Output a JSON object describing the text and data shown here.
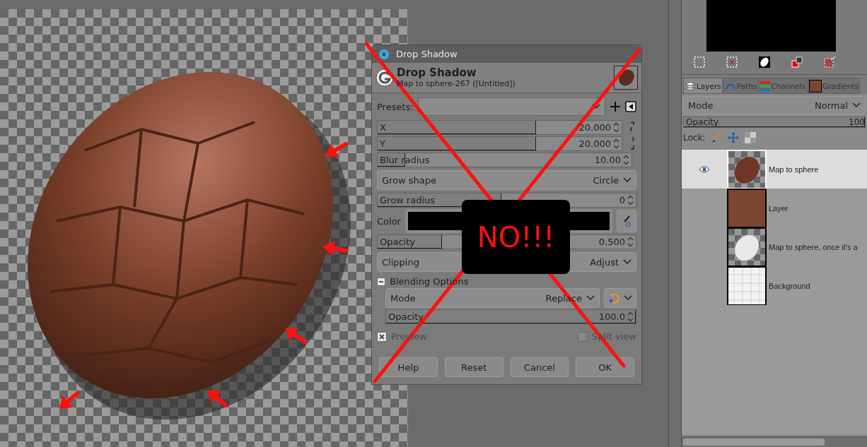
{
  "dialog": {
    "title": "Drop Shadow",
    "heading": "Drop Shadow",
    "subtitle": "Map to sphere-267 ([Untitled])",
    "presets_label": "Presets:",
    "fields": [
      {
        "kind": "slider",
        "label": "X",
        "value": "20.000",
        "level": 0.65
      },
      {
        "kind": "slider",
        "label": "Y",
        "value": "20.000",
        "level": 0.65
      },
      {
        "kind": "slider",
        "label": "Blur radius",
        "value": "10.00",
        "level": 0.11
      },
      {
        "kind": "select",
        "label": "Grow shape",
        "value": "Circle"
      },
      {
        "kind": "slider",
        "label": "Grow radius",
        "value": "0",
        "level": 0.48
      },
      {
        "kind": "color",
        "label": "Color"
      },
      {
        "kind": "slider",
        "label": "Opacity",
        "value": "0.500",
        "level": 0.25
      },
      {
        "kind": "select",
        "label": "Clipping",
        "value": "Adjust"
      }
    ],
    "blending": {
      "label": "Blending Options",
      "expanded": true,
      "mode_label": "Mode",
      "mode_value": "Replace",
      "opacity": {
        "label": "Opacity",
        "value": "100.0",
        "level": 1
      }
    },
    "preview": {
      "label": "Preview",
      "checked": true
    },
    "split_view": {
      "label": "Split view",
      "checked": false
    },
    "buttons": [
      "Help",
      "Reset",
      "Cancel",
      "OK"
    ]
  },
  "stamp": "NO!!!",
  "layers_panel": {
    "tabs": [
      {
        "label": "Layers",
        "selected": true
      },
      {
        "label": "Paths",
        "selected": false
      },
      {
        "label": "Channels",
        "selected": false
      },
      {
        "label": "Gradients",
        "selected": false
      }
    ],
    "mode_label": "Mode",
    "mode_value": "Normal",
    "opacity": {
      "label": "Opacity",
      "value": "100",
      "level": 1
    },
    "lock_label": "Lock:",
    "layers": [
      {
        "name": "Map to sphere",
        "kind": "egg",
        "selected": true,
        "visible": true
      },
      {
        "name": "Layer",
        "kind": "fill",
        "selected": false,
        "visible": false
      },
      {
        "name": "Map to sphere, once it's a",
        "kind": "white-egg",
        "selected": false,
        "visible": false
      },
      {
        "name": "Background",
        "kind": "pattern",
        "selected": false,
        "visible": false
      }
    ]
  }
}
